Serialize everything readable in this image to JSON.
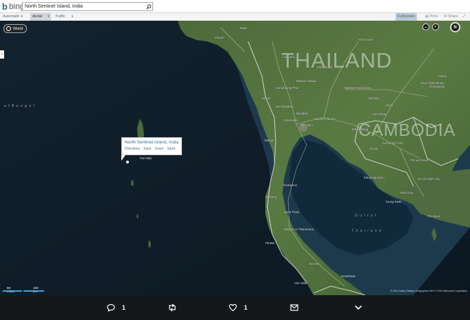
{
  "header": {
    "logo_text": "bing",
    "search_value": "North Sentinel Island, India"
  },
  "toolbar": {
    "automatic": "Automatic",
    "aerial": "Aerial",
    "traffic": "Traffic",
    "fullscreen": "Fullscreen",
    "print": "Print",
    "share": "Share"
  },
  "map": {
    "world_button": "World",
    "compass": "N",
    "countries": [
      "THAILAND",
      "CAMBODIA"
    ],
    "seas": [
      "a f  B e n g a l",
      "G u l f  o f",
      "T h a i l a n d"
    ],
    "places": [
      "Yangon",
      "Bago",
      "Dawei",
      "Port Blair",
      "Bangkok",
      "Phet Buri",
      "Ratchaburi",
      "Kanchanaburi",
      "Nakhon Pathom",
      "Chumphon",
      "Ranong",
      "Surat Thani",
      "Nakhon Si Thammarat",
      "Phuket",
      "Hat Yai",
      "Alor Setar",
      "Narathiwat",
      "Phnom Penh",
      "Ho Chi Minh City",
      "Rach Gia",
      "Phu Quoc",
      "Kampong Speu",
      "Siem Reap",
      "Battambang",
      "Kampong Thom",
      "Khon Kaen",
      "Nakhon Ratchasima",
      "Ubon Ratchathani",
      "Pakse",
      "Champasak",
      "Pursat",
      "Krong Kaeb",
      "Mergui",
      "Nakhon Sawan",
      "Phitsanulok",
      "Lampang",
      "Kamphaeng Phet",
      "Buriram",
      "Surin"
    ],
    "popup": {
      "title": "North Sentinel Island, India",
      "actions": [
        "Directions",
        "Save",
        "Zoom",
        "Send"
      ]
    },
    "scale": {
      "miles": "50 miles",
      "km": "100 km"
    },
    "attribution": "© 2013 Nokia  ©allstar Geographics SIO  © 2014 Microsoft Corporation"
  },
  "tweet_actions": {
    "reply_count": "1",
    "like_count": "1"
  }
}
